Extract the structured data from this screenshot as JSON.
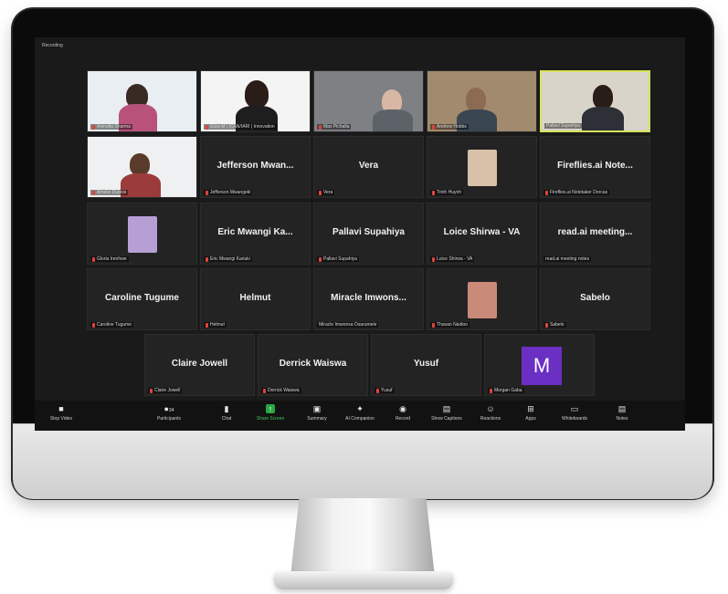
{
  "screen": {
    "recording_label": "Recording"
  },
  "tiles": [
    {
      "name": "Anindita Sharma"
    },
    {
      "name": "Eliza M | ICAN/IARI | Innovation"
    },
    {
      "name": "Max Pichalla"
    },
    {
      "name": "Andrew Hobbs"
    },
    {
      "name": "Pallavi Supahiya"
    },
    {
      "name": "Amelie Dubois"
    },
    {
      "display": "Jefferson  Mwan...",
      "name": "Jefferson Mwangeki"
    },
    {
      "display": "Vera",
      "name": "Vera"
    },
    {
      "name": "Trinh Huynh"
    },
    {
      "display": "Fireflies.ai  Note...",
      "name": "Fireflies.ai Notetaker Dorcas"
    },
    {
      "name": "Gloria Irenhwe"
    },
    {
      "display": "Eric  Mwangi  Ka...",
      "name": "Eric Mwangi Kariuki"
    },
    {
      "display": "Pallavi Supahiya",
      "name": "Pallavi Supahiya"
    },
    {
      "display": "Loice  Shirwa  -  VA",
      "name": "Loice Shirwa - VA"
    },
    {
      "display": "read.ai  meeting...",
      "name": "read.ai meeting notes"
    },
    {
      "display": "Caroline Tugume",
      "name": "Caroline Tugume"
    },
    {
      "display": "Helmut",
      "name": "Helmut"
    },
    {
      "display": "Miracle  Imwons...",
      "name": "Miracle Imwonsa Osarumele"
    },
    {
      "name": "Thavan Naidoo"
    },
    {
      "display": "Sabelo",
      "name": "Sabelo"
    },
    {
      "display": "Claire Jowell",
      "name": "Claire Jowell"
    },
    {
      "display": "Derrick Waiswa",
      "name": "Derrick Waiswa"
    },
    {
      "display": "Yusuf",
      "name": "Yusuf"
    },
    {
      "avatar": "M",
      "name": "Morgan Gaba"
    }
  ],
  "toolbar": {
    "stop_video": "Stop Video",
    "participants": "Participants",
    "participants_count": "24",
    "chat": "Chat",
    "share_screen": "Share Screen",
    "summary": "Summary",
    "ai_companion": "AI Companion",
    "record": "Record",
    "show_captions": "Show Captions",
    "reactions": "Reactions",
    "apps": "Apps",
    "whiteboards": "Whiteboards",
    "notes": "Notes"
  }
}
